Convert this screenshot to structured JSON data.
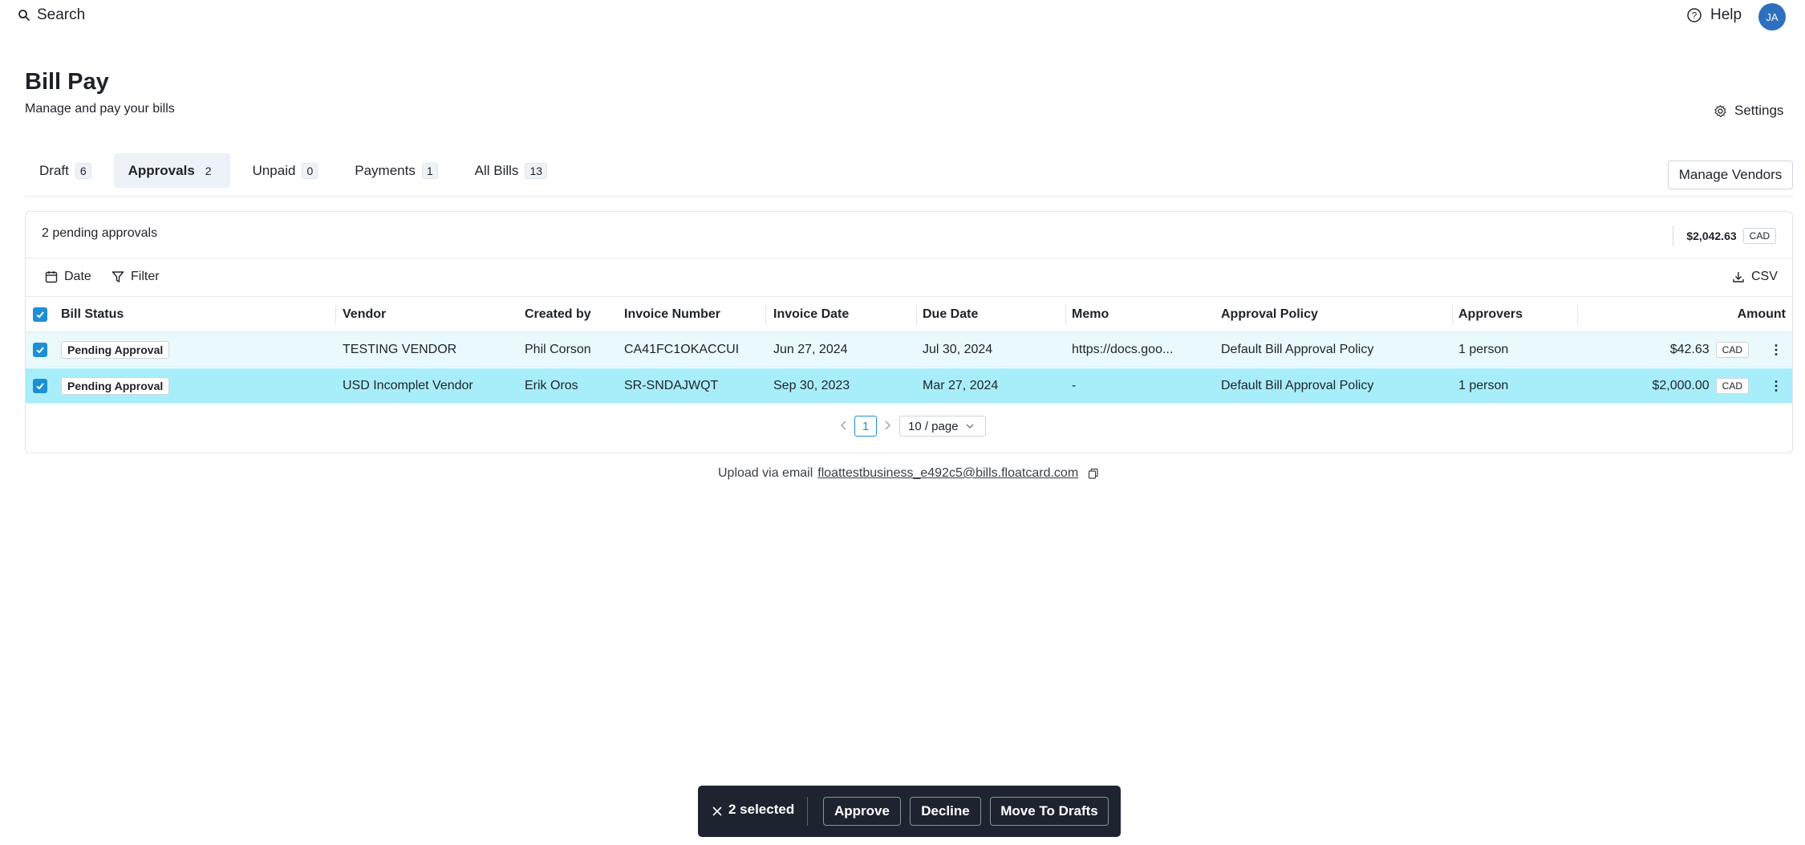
{
  "topbar": {
    "search_label": "Search",
    "help_label": "Help",
    "avatar_initials": "JA"
  },
  "header": {
    "title": "Bill Pay",
    "subtitle": "Manage and pay your bills",
    "settings_label": "Settings"
  },
  "tabs": [
    {
      "label": "Draft",
      "count": "6"
    },
    {
      "label": "Approvals",
      "count": "2",
      "active": true
    },
    {
      "label": "Unpaid",
      "count": "0"
    },
    {
      "label": "Payments",
      "count": "1"
    },
    {
      "label": "All Bills",
      "count": "13"
    }
  ],
  "manage_vendors_label": "Manage Vendors",
  "summary": {
    "pending_text": "2 pending approvals",
    "total_amount": "$2,042.63",
    "total_currency": "CAD"
  },
  "toolbar": {
    "date_label": "Date",
    "filter_label": "Filter",
    "csv_label": "CSV"
  },
  "table": {
    "columns": [
      "Bill Status",
      "Vendor",
      "Created by",
      "Invoice Number",
      "Invoice Date",
      "Due Date",
      "Memo",
      "Approval Policy",
      "Approvers",
      "Amount"
    ],
    "rows": [
      {
        "status": "Pending Approval",
        "vendor": "TESTING VENDOR",
        "created_by": "Phil Corson",
        "invoice_number": "CA41FC1OKACCUI",
        "invoice_date": "Jun 27, 2024",
        "due_date": "Jul 30, 2024",
        "memo": "https://docs.goo...",
        "approval_policy": "Default Bill Approval Policy",
        "approvers": "1 person",
        "amount": "$42.63",
        "currency": "CAD"
      },
      {
        "status": "Pending Approval",
        "vendor": "USD Incomplet Vendor",
        "created_by": "Erik Oros",
        "invoice_number": "SR-SNDAJWQT",
        "invoice_date": "Sep 30, 2023",
        "due_date": "Mar 27, 2024",
        "memo": "-",
        "approval_policy": "Default Bill Approval Policy",
        "approvers": "1 person",
        "amount": "$2,000.00",
        "currency": "CAD"
      }
    ]
  },
  "pagination": {
    "current_page": "1",
    "page_size": "10 / page"
  },
  "upload": {
    "prefix": "Upload via email",
    "email": "floattestbusiness_e492c5@bills.floatcard.com"
  },
  "bulk_actions": {
    "selected_text": "2 selected",
    "approve_label": "Approve",
    "decline_label": "Decline",
    "move_label": "Move To Drafts"
  },
  "colors": {
    "accent": "#1c8fd6",
    "selected_row": "#a8eefa",
    "hover_row": "#e9f9fc",
    "bulkbar": "#1d2430",
    "avatar": "#2e6fbf"
  }
}
